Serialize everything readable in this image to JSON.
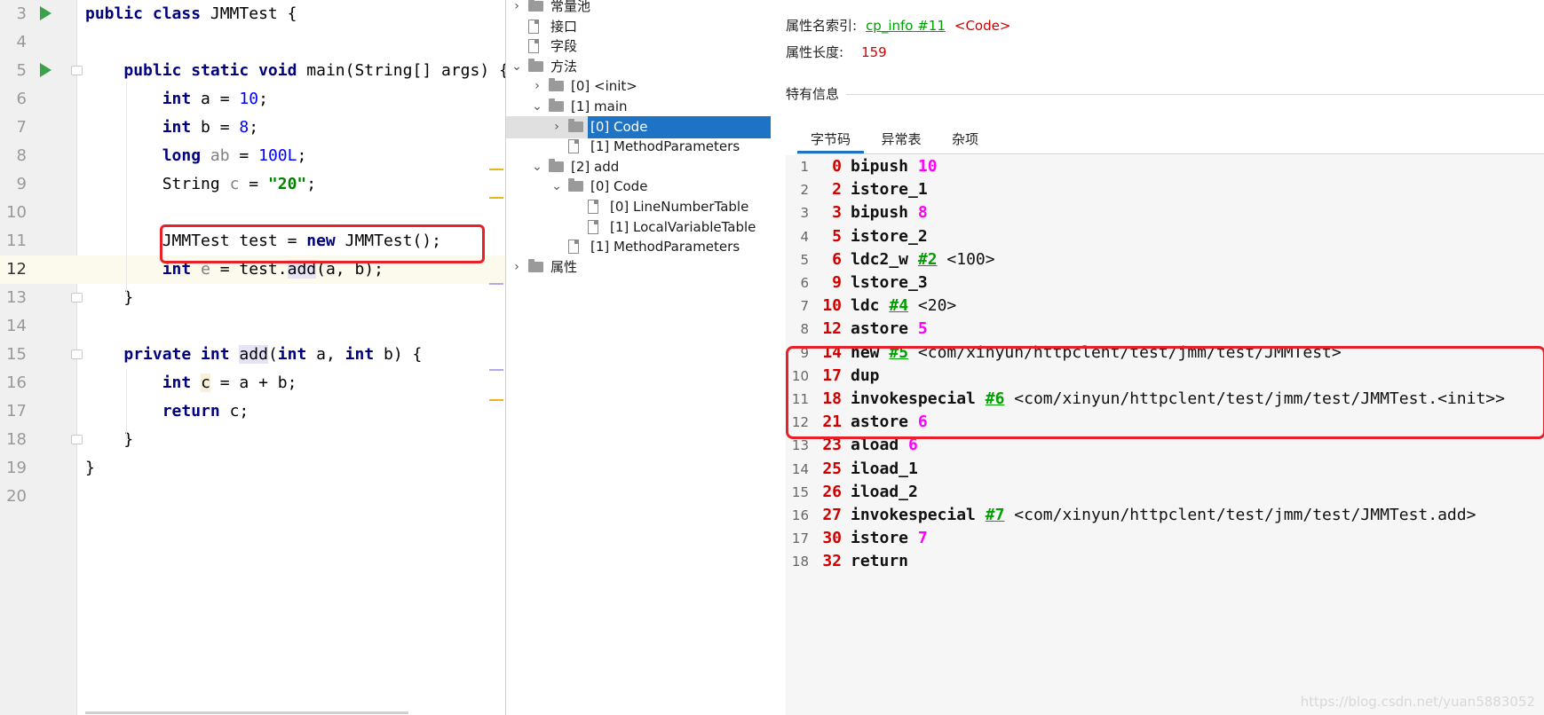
{
  "editor": {
    "lines": [
      {
        "n": "3",
        "run": true,
        "html": "<span class=\"kw\">public class</span> JMMTest {"
      },
      {
        "n": "4",
        "html": ""
      },
      {
        "n": "5",
        "run": true,
        "fold": true,
        "html": "    <span class=\"kw\">public static void</span> main(String[] args) {"
      },
      {
        "n": "6",
        "html": "        <span class=\"kw\">int</span> a = <span class=\"num\">10</span>;"
      },
      {
        "n": "7",
        "html": "        <span class=\"kw\">int</span> b = <span class=\"num\">8</span>;"
      },
      {
        "n": "8",
        "html": "        <span class=\"kw\">long</span> <span class=\"unused\">ab</span> = <span class=\"num\">100L</span>;"
      },
      {
        "n": "9",
        "html": "        String <span class=\"unused\">c</span> = <span class=\"str\">\"20\"</span>;"
      },
      {
        "n": "10",
        "html": ""
      },
      {
        "n": "11",
        "html": "        JMMTest test = <span class=\"kw\">new</span> JMMTest();"
      },
      {
        "n": "12",
        "current": true,
        "html": "        <span class=\"kw\">int</span> <span class=\"unused\">e</span> = test.<span class=\"hl\">add</span>(a, b);"
      },
      {
        "n": "13",
        "fold": true,
        "html": "    }"
      },
      {
        "n": "14",
        "html": ""
      },
      {
        "n": "15",
        "fold": true,
        "html": "    <span class=\"kw\">private int</span> <span class=\"hl\">add</span>(<span class=\"kw\">int</span> a, <span class=\"kw\">int</span> b) {"
      },
      {
        "n": "16",
        "html": "        <span class=\"kw\">int</span> <span class=\"hl-y\">c</span> = a + b;"
      },
      {
        "n": "17",
        "html": "        <span class=\"kw\">return</span> c;"
      },
      {
        "n": "18",
        "fold": true,
        "html": "    }"
      },
      {
        "n": "19",
        "html": "}"
      },
      {
        "n": "20",
        "html": ""
      }
    ]
  },
  "tree": {
    "nodes": [
      {
        "label": "常量池",
        "icon": "folder",
        "arrow": "›",
        "indent": 0
      },
      {
        "label": "接口",
        "icon": "file",
        "indent": 0
      },
      {
        "label": "字段",
        "icon": "file",
        "indent": 0
      },
      {
        "label": "方法",
        "icon": "folder",
        "arrow": "⌄",
        "indent": 0
      },
      {
        "label": "[0] <init>",
        "icon": "folder",
        "arrow": "›",
        "indent": 1
      },
      {
        "label": "[1] main",
        "icon": "folder",
        "arrow": "⌄",
        "indent": 1
      },
      {
        "label": "[0] Code",
        "icon": "folder",
        "arrow": "›",
        "indent": 2,
        "selected": true
      },
      {
        "label": "[1] MethodParameters",
        "icon": "file",
        "indent": 2
      },
      {
        "label": "[2] add",
        "icon": "folder",
        "arrow": "⌄",
        "indent": 1
      },
      {
        "label": "[0] Code",
        "icon": "folder",
        "arrow": "⌄",
        "indent": 2
      },
      {
        "label": "[0] LineNumberTable",
        "icon": "file",
        "indent": 3
      },
      {
        "label": "[1] LocalVariableTable",
        "icon": "file",
        "indent": 3
      },
      {
        "label": "[1] MethodParameters",
        "icon": "file",
        "indent": 2
      },
      {
        "label": "属性",
        "icon": "folder",
        "arrow": "›",
        "indent": 0
      }
    ]
  },
  "detail": {
    "attr_name_label": "属性名索引:",
    "attr_name_link": "cp_info #11",
    "attr_name_value": "<Code>",
    "attr_len_label": "属性长度:",
    "attr_len_value": "159",
    "special_info": "特有信息",
    "tabs": [
      "字节码",
      "异常表",
      "杂项"
    ],
    "active_tab": 0
  },
  "bytecode": [
    {
      "ln": "1",
      "off": "0",
      "op": "bipush",
      "arg": "10"
    },
    {
      "ln": "2",
      "off": "2",
      "op": "istore_1"
    },
    {
      "ln": "3",
      "off": "3",
      "op": "bipush",
      "arg": "8"
    },
    {
      "ln": "4",
      "off": "5",
      "op": "istore_2"
    },
    {
      "ln": "5",
      "off": "6",
      "op": "ldc2_w",
      "ref": "#2",
      "cmt": "<100>"
    },
    {
      "ln": "6",
      "off": "9",
      "op": "lstore_3"
    },
    {
      "ln": "7",
      "off": "10",
      "op": "ldc",
      "ref": "#4",
      "cmt": "<20>"
    },
    {
      "ln": "8",
      "off": "12",
      "op": "astore",
      "arg": "5"
    },
    {
      "ln": "9",
      "off": "14",
      "op": "new",
      "ref": "#5",
      "cmt": "<com/xinyun/httpclent/test/jmm/test/JMMTest>"
    },
    {
      "ln": "10",
      "off": "17",
      "op": "dup"
    },
    {
      "ln": "11",
      "off": "18",
      "op": "invokespecial",
      "ref": "#6",
      "cmt": "<com/xinyun/httpclent/test/jmm/test/JMMTest.<init>>"
    },
    {
      "ln": "12",
      "off": "21",
      "op": "astore",
      "arg": "6"
    },
    {
      "ln": "13",
      "off": "23",
      "op": "aload",
      "arg": "6"
    },
    {
      "ln": "14",
      "off": "25",
      "op": "iload_1"
    },
    {
      "ln": "15",
      "off": "26",
      "op": "iload_2"
    },
    {
      "ln": "16",
      "off": "27",
      "op": "invokespecial",
      "ref": "#7",
      "cmt": "<com/xinyun/httpclent/test/jmm/test/JMMTest.add>"
    },
    {
      "ln": "17",
      "off": "30",
      "op": "istore",
      "arg": "7"
    },
    {
      "ln": "18",
      "off": "32",
      "op": "return"
    }
  ],
  "watermark": "https://blog.csdn.net/yuan5883052",
  "colors": {
    "accent": "#1e73c5",
    "highlight_box": "#e8202a",
    "link": "#00a000",
    "offset": "#d00000",
    "arg": "#ff00ff"
  }
}
